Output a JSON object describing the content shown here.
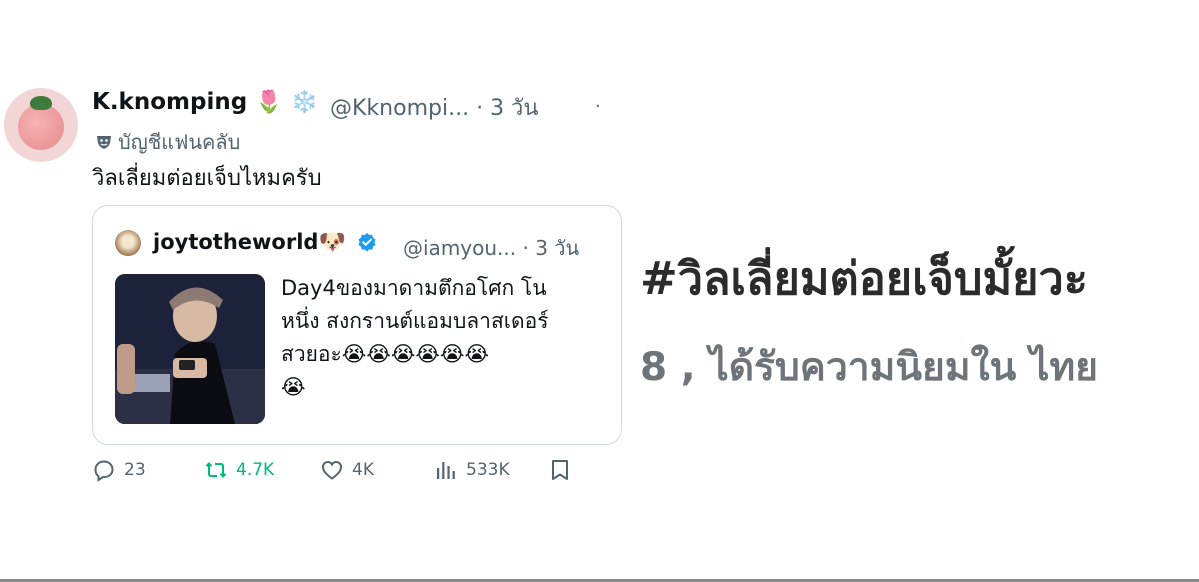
{
  "tweet": {
    "display_name": "K.knomping",
    "name_emojis": [
      "🌷",
      "❄️"
    ],
    "handle": "@Kknompi...",
    "separator": "·",
    "time": "3 วัน",
    "fan_label": "บัญชีแฟนคลับ",
    "more_mark": "·",
    "text": "วิลเลี่ยมต่อยเจ็บไหมครับ",
    "quote": {
      "display_name": "joytotheworld",
      "name_emoji": "🐶",
      "handle": "@iamyou...",
      "separator": "·",
      "time": "3 วัน",
      "text_lines": [
        "Day4ของมาดามตึกอโศก โน",
        "หนึ่ง สงกรานต์แอมบลาสเดอร์",
        "สวยอะ😭😭😭😭😭😭",
        "😭"
      ]
    },
    "actions": {
      "reply": "23",
      "retweet": "4.7K",
      "like": "4K",
      "views": "533K"
    }
  },
  "trending": {
    "hashtag": "#วิลเลี่ยมต่อยเจ็บมั้ยวะ",
    "rank_text": "8 , ได้รับความนิยมใน ไทย"
  },
  "colors": {
    "text": "#0f1419",
    "muted": "#536471",
    "retweet": "#00ba7c",
    "verified": "#1d9bf0",
    "border": "#cfd9de"
  }
}
